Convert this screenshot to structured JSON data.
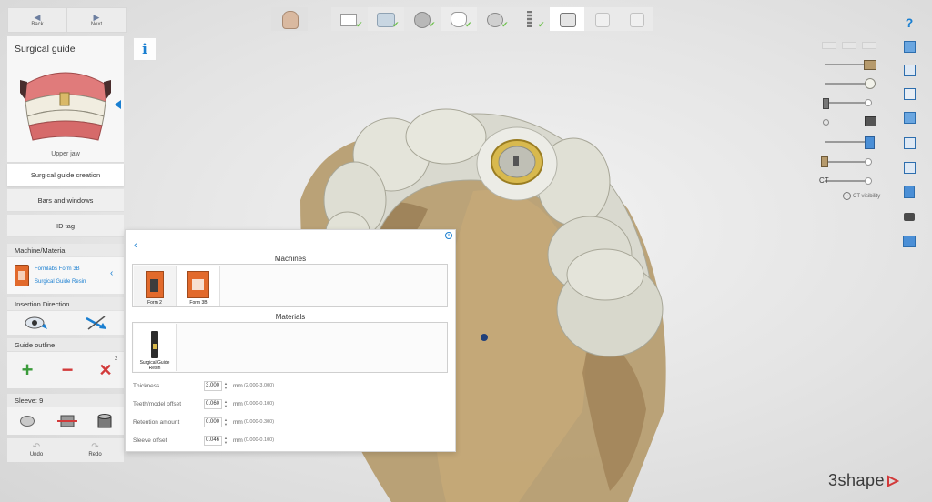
{
  "nav": {
    "back_label": "Back",
    "next_label": "Next"
  },
  "panel": {
    "title": "Surgical guide",
    "jaw_label": "Upper jaw",
    "tabs": [
      {
        "label": "Surgical guide creation"
      },
      {
        "label": "Bars and windows"
      },
      {
        "label": "ID tag"
      }
    ]
  },
  "machine_material": {
    "header": "Machine/Material",
    "machine": "Formlabs Form 3B",
    "material": "Surgical Guide Resin"
  },
  "insertion": {
    "header": "Insertion Direction"
  },
  "guide_outline": {
    "header": "Guide outline",
    "count": "2"
  },
  "sleeve": {
    "header": "Sleeve: 9"
  },
  "history": {
    "undo_label": "Undo",
    "redo_label": "Redo"
  },
  "dialog": {
    "machines_header": "Machines",
    "machines": [
      {
        "label": "Form 2"
      },
      {
        "label": "Form 3B"
      }
    ],
    "materials_header": "Materials",
    "materials": [
      {
        "label": "Surgical Guide Resin"
      }
    ],
    "params": [
      {
        "label": "Thickness",
        "value": "3.000",
        "unit": "mm",
        "range": "(2.000-3.000)"
      },
      {
        "label": "Teeth/model offset",
        "value": "0.060",
        "unit": "mm",
        "range": "(0.000-0.100)"
      },
      {
        "label": "Retention amount",
        "value": "0.000",
        "unit": "mm",
        "range": "(0.000-0.300)"
      },
      {
        "label": "Sleeve offset",
        "value": "0.046",
        "unit": "mm",
        "range": "(0.000-0.100)"
      }
    ]
  },
  "visibility": {
    "ct_label": "CT",
    "ct_visibility_label": "CT visibility",
    "slider_levels": [
      0.95,
      0.95,
      0.95,
      0.0,
      0.95,
      0.95,
      0.95
    ]
  },
  "brand": {
    "logo_text": "3shape"
  },
  "colors": {
    "accent": "#1a7fd1",
    "check": "#6cc04a",
    "add": "#3a9b3a",
    "remove": "#d23a3a",
    "printer": "#e26a2c"
  },
  "icons": {
    "info": "info-icon",
    "help": "help-icon",
    "collapse": "chevron-left-icon"
  }
}
